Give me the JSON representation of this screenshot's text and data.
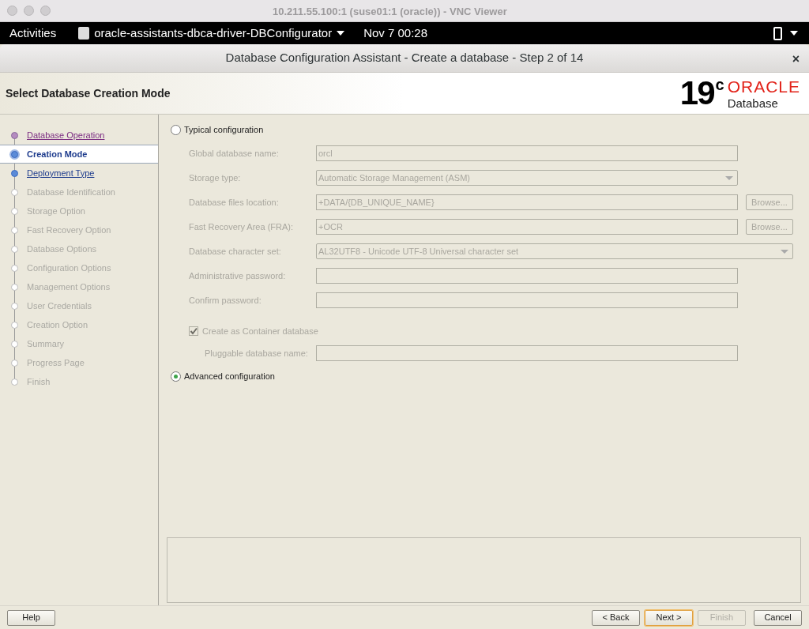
{
  "mac_window": {
    "title": "10.211.55.100:1 (suse01:1 (oracle)) - VNC Viewer"
  },
  "top_bar": {
    "activities": "Activities",
    "app_menu": "oracle-assistants-dbca-driver-DBConfigurator",
    "clock": "Nov 7  00:28"
  },
  "dialog": {
    "title": "Database Configuration Assistant - Create a database - Step 2 of 14",
    "close": "×"
  },
  "header": {
    "title": "Select Database Creation Mode",
    "logo_version": "19",
    "logo_suffix": "c",
    "logo_brand": "ORACLE",
    "logo_product": "Database"
  },
  "steps": [
    {
      "label": "Database Operation",
      "kind": "visited",
      "selected": false
    },
    {
      "label": "Creation Mode",
      "kind": "current",
      "selected": true
    },
    {
      "label": "Deployment Type",
      "kind": "available",
      "selected": false
    },
    {
      "label": "Database Identification",
      "kind": "pending",
      "selected": false
    },
    {
      "label": "Storage Option",
      "kind": "pending",
      "selected": false
    },
    {
      "label": "Fast Recovery Option",
      "kind": "pending",
      "selected": false
    },
    {
      "label": "Database Options",
      "kind": "pending",
      "selected": false
    },
    {
      "label": "Configuration Options",
      "kind": "pending",
      "selected": false
    },
    {
      "label": "Management Options",
      "kind": "pending",
      "selected": false
    },
    {
      "label": "User Credentials",
      "kind": "pending",
      "selected": false
    },
    {
      "label": "Creation Option",
      "kind": "pending",
      "selected": false
    },
    {
      "label": "Summary",
      "kind": "pending",
      "selected": false
    },
    {
      "label": "Progress Page",
      "kind": "pending",
      "selected": false
    },
    {
      "label": "Finish",
      "kind": "pending",
      "selected": false
    }
  ],
  "modes": [
    {
      "label": "Typical configuration",
      "selected": false,
      "disabled": true,
      "fields": [
        {
          "label": "Global database name:",
          "kind": "text",
          "value": "orcl"
        },
        {
          "label": "Storage type:",
          "kind": "combo",
          "value": "Automatic Storage Management (ASM)"
        },
        {
          "label": "Database files location:",
          "kind": "text",
          "value": "+DATA/{DB_UNIQUE_NAME}",
          "button": "Browse..."
        },
        {
          "label": "Fast Recovery Area (FRA):",
          "kind": "text",
          "value": "+OCR",
          "button": "Browse..."
        },
        {
          "label": "Database character set:",
          "kind": "combo",
          "value": "AL32UTF8 - Unicode UTF-8 Universal character set",
          "full_width": true
        },
        {
          "label": "Administrative password:",
          "kind": "text"
        },
        {
          "label": "Confirm password:",
          "kind": "text"
        }
      ],
      "container_checkbox": {
        "label": "Create as Container database",
        "checked": true
      },
      "pluggable_field": {
        "label": "Pluggable database name:"
      }
    },
    {
      "label": "Advanced configuration",
      "selected": true
    }
  ],
  "buttons": {
    "help": "Help",
    "back": "< Back",
    "next": "Next >",
    "finish": {
      "label": "Finish",
      "disabled": true
    },
    "cancel": "Cancel"
  }
}
